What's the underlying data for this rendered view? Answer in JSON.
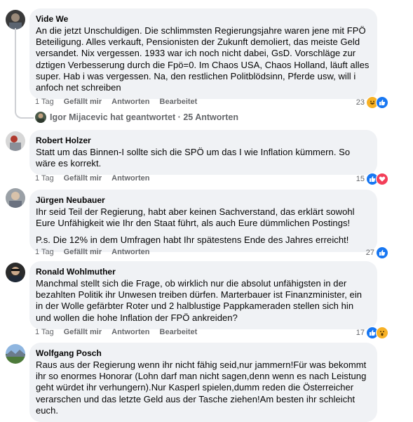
{
  "comments": [
    {
      "author": "Vide We",
      "paragraphs": [
        "An die jetzt Unschuldigen. Die schlimmsten Regierungsjahre waren jene mit FPÖ Beteiligung. Alles verkauft, Pensionisten der Zukunft demoliert, das meiste Geld versandet. Nix vergessen. 1933 war ich noch nicht dabei, GsD. Vorschläge zur dztigen Verbesserung durch die Fpö=0. Im Chaos USA, Chaos Holland, läuft alles super. Hab i was vergessen. Na, den restlichen Politblödsinn, Pferde usw, will i anfoch net schreiben"
      ],
      "time": "1 Tag",
      "like": "Gefällt mir",
      "reply": "Antworten",
      "edited": "Bearbeitet",
      "count": "23",
      "reactions": [
        "haha-icon",
        "like-icon"
      ]
    },
    {
      "author": "Robert Holzer",
      "paragraphs": [
        "Statt um das Binnen-I sollte sich die SPÖ um das I wie Inflation kümmern. So wäre es korrekt."
      ],
      "time": "1 Tag",
      "like": "Gefällt mir",
      "reply": "Antworten",
      "edited": "",
      "count": "15",
      "reactions": [
        "like-icon",
        "love-icon"
      ]
    },
    {
      "author": "Jürgen Neubauer",
      "paragraphs": [
        "Ihr seid Teil der Regierung, habt aber keinen Sachverstand, das erklärt sowohl Eure Unfähigkeit wie Ihr den Staat führt, als auch Eure dümmlichen Postings!",
        "P.s. Die 12% in dem Umfragen habt Ihr spätestens Ende des Jahres erreicht!"
      ],
      "time": "1 Tag",
      "like": "Gefällt mir",
      "reply": "Antworten",
      "edited": "",
      "count": "27",
      "reactions": [
        "like-icon"
      ]
    },
    {
      "author": "Ronald Wohlmuther",
      "paragraphs": [
        "Manchmal stellt sich die Frage, ob wirklich nur die absolut unfähigsten in der bezahlten Politik ihr Unwesen treiben dürfen. Marterbauer ist Finanzminister, ein in der Wolle gefärbter Roter und 2 halblustige Pappkameraden stellen sich hin und wollen die hohe Inflation der FPÖ ankreiden?"
      ],
      "time": "1 Tag",
      "like": "Gefällt mir",
      "reply": "Antworten",
      "edited": "Bearbeitet",
      "count": "17",
      "reactions": [
        "like-icon",
        "wow-icon"
      ]
    },
    {
      "author": "Wolfgang Posch",
      "paragraphs": [
        "Raus aus der Regierung wenn ihr nicht fähig seid,nur jammern!Für was bekommt ihr so enormes Honorar (Lohn darf man nicht sagen,denn wenn es nach Leistung geht würdet ihr verhungern).Nur Kasperl spielen,dumm reden die Österreicher verarschen und das letzte Geld aus der Tasche ziehen!Am besten ihr schleicht euch."
      ],
      "time": "",
      "like": "",
      "reply": "",
      "edited": "",
      "count": "",
      "reactions": []
    }
  ],
  "thread_reply": {
    "text": "Igor Mijacevic hat geantwortet · 25 Antworten"
  },
  "colors": {
    "like": "#1877f2",
    "love": "#f33e58",
    "haha": "#f7b125",
    "muted_text": "#65676b",
    "bubble_bg": "#f0f2f5"
  }
}
